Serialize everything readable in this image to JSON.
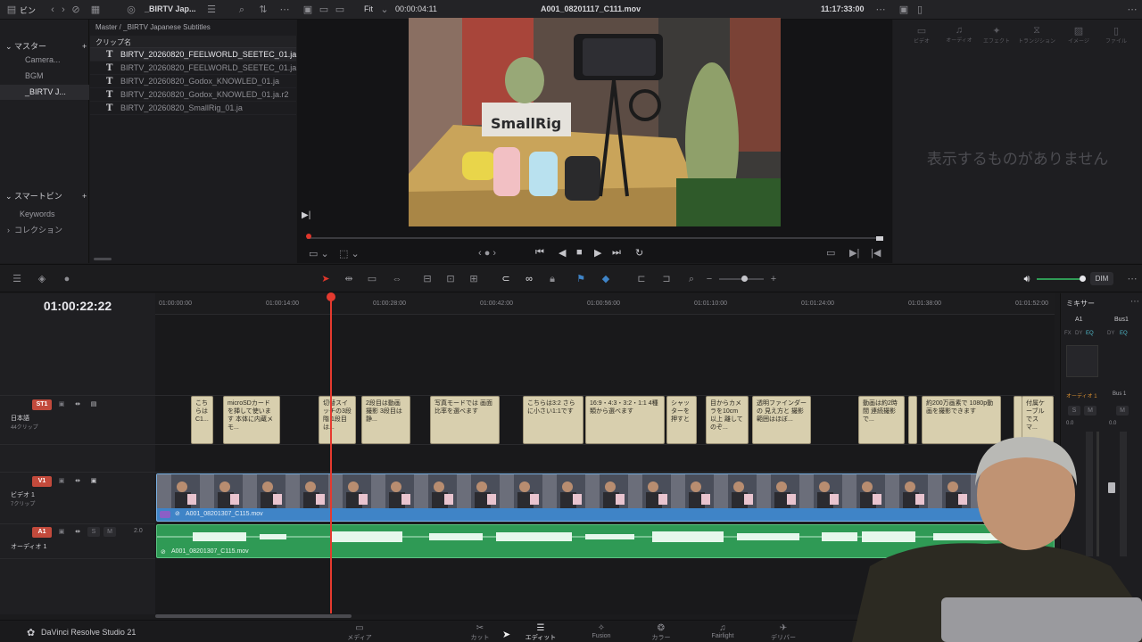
{
  "app": {
    "name": "DaVinci Resolve Studio 21",
    "colors": {
      "accent_red": "#e0362b",
      "video_blue": "#3f84c7",
      "audio_green": "#2f9a55",
      "subtitle_tan": "#d8cfae",
      "playhead": "#e53a2f"
    }
  },
  "topbar": {
    "bin_label": "ビン",
    "project_title": "_BIRTV Jap...",
    "viewer_zoom": "Fit",
    "source_duration": "00:00:04:11",
    "clip_name": "A001_08201117_C111.mov",
    "source_timecode": "11:17:33:00"
  },
  "bins": {
    "master_label": "マスター",
    "items": [
      "Camera...",
      "BGM",
      "_BIRTV J..."
    ],
    "smart_bins_label": "スマートビン",
    "smart_items": [
      "Keywords",
      "コレクション"
    ]
  },
  "clips": {
    "path": "Master / _BIRTV Japanese Subtitles",
    "column_header": "クリップ名",
    "files": [
      "BIRTV_20260820_FEELWORLD_SEETEC_01.ja",
      "BIRTV_20260820_FEELWORLD_SEETEC_01.ja...",
      "BIRTV_20260820_Godox_KNOWLED_01.ja",
      "BIRTV_20260820_Godox_KNOWLED_01.ja.r2",
      "BIRTV_20260820_SmallRig_01.ja"
    ]
  },
  "inspector": {
    "tabs": [
      "ビデオ",
      "オーディオ",
      "エフェクト",
      "トランジション",
      "イメージ",
      "ファイル"
    ],
    "empty_message": "表示するものがありません"
  },
  "timeline": {
    "current_timecode": "01:00:22:22",
    "ruler_ticks": [
      "01:00:00:00",
      "01:00:14:00",
      "01:00:28:00",
      "01:00:42:00",
      "01:00:56:00",
      "01:01:10:00",
      "01:01:24:00",
      "01:01:38:00",
      "01:01:52:00"
    ],
    "subtitle_track": {
      "id": "ST1",
      "name": "日本語",
      "count": "44クリップ"
    },
    "video_track": {
      "id": "V1",
      "name": "ビデオ 1",
      "count": "7クリップ",
      "clip_name": "A001_08201307_C115.mov"
    },
    "audio_track": {
      "id": "A1",
      "name": "オーディオ 1",
      "level": "2.0",
      "clip_name": "A001_08201307_C115.mov"
    },
    "subtitles": [
      "こちらはC1...",
      "microSDカードを挿して使います 本体に内蔵メモ...",
      "切替スイッチの3段階 1段目は...",
      "2段目は動画撮影 3段目は静...",
      "写真モードでは 画面比率を選べます",
      "こちらは3:2 さらに小さい1:1です",
      "16:9・4:3・3:2・1:1 4種類から選べます",
      "シャッターを押すと",
      "目からカメラを10cm以上 離してのぞ...",
      "透明ファインダーの 見え方と 撮影範囲はほぼ...",
      "動画は約2時間 連続撮影で...",
      "約200万画素で 1080p動画を撮影できます",
      "付属ケーブルでスマ..."
    ]
  },
  "audio": {
    "volume_label": "DIM"
  },
  "mixer": {
    "title": "ミキサー",
    "channels": [
      "A1",
      "Bus1"
    ],
    "fx_labels": [
      "FX",
      "DY",
      "EQ"
    ],
    "track_labels": [
      "オーディオ 1",
      "Bus 1"
    ],
    "solo": "S",
    "mute": "M",
    "meter_values": [
      "0.0",
      "0.0"
    ],
    "scale": [
      "0",
      "5",
      "10",
      "15",
      "20",
      "25"
    ]
  },
  "pages": [
    "メディア",
    "カット",
    "エディット",
    "Fusion",
    "カラー",
    "Fairlight",
    "デリバー"
  ]
}
